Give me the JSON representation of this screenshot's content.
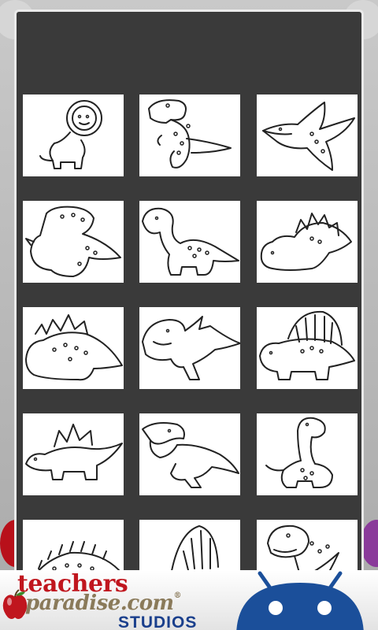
{
  "dialog": {
    "thumbnails": [
      {
        "name": "dino-astronaut"
      },
      {
        "name": "trex-standing"
      },
      {
        "name": "pterodactyl"
      },
      {
        "name": "triceratops"
      },
      {
        "name": "brontosaurus"
      },
      {
        "name": "stegosaurus"
      },
      {
        "name": "stegosaurus-spotted"
      },
      {
        "name": "raptor-spiky"
      },
      {
        "name": "dimetrodon"
      },
      {
        "name": "stegosaurus-walking"
      },
      {
        "name": "trex-roaring"
      },
      {
        "name": "long-neck-dino"
      },
      {
        "name": "spiky-back-dino"
      },
      {
        "name": "spinosaurus"
      },
      {
        "name": "trex-happy"
      }
    ]
  },
  "ad_banner": {
    "line1": "teachers",
    "line2": "paradise.com",
    "reg_mark": "®",
    "line3": "STUDIOS",
    "icons": [
      "apple-icon",
      "android-robot-icon"
    ]
  },
  "colors": {
    "brand_red": "#c0161e",
    "brand_blue": "#1a3f8c",
    "dialog_bg": "#3a3a3a"
  }
}
